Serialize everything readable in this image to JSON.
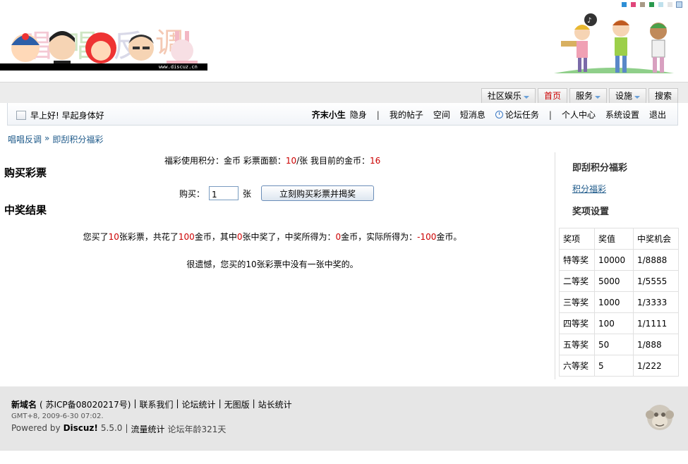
{
  "header": {
    "logo_url_text": "www.discuz.cn",
    "swatch_colors": [
      "#2e8fd6",
      "#e0457a",
      "#a89a86",
      "#2a9a4e",
      "#bfe0ec",
      "#e4e4e4",
      "#c0d8ee"
    ]
  },
  "nav": {
    "menu": [
      {
        "label": "社区娱乐",
        "dropdown": true,
        "active": false
      },
      {
        "label": "首页",
        "dropdown": false,
        "active": true
      },
      {
        "label": "服务",
        "dropdown": true,
        "active": false
      },
      {
        "label": "设施",
        "dropdown": true,
        "active": false
      },
      {
        "label": "搜索",
        "dropdown": false,
        "active": false
      }
    ]
  },
  "userbar": {
    "greeting": "早上好! 早起身体好",
    "username": "齐末小生",
    "invisible": "隐身",
    "my_posts": "我的帖子",
    "space": "空间",
    "messages": "短消息",
    "tasks": "论坛任务",
    "user_center": "个人中心",
    "settings": "系统设置",
    "logout": "退出",
    "separator": "|"
  },
  "breadcrumb": {
    "forum": "唱唱反调",
    "sep": "»",
    "current": "即刮积分福彩"
  },
  "main": {
    "info_prefix": "福彩使用积分：金币  彩票面额：",
    "ticket_price": "10",
    "info_mid": "/张  我目前的金币：",
    "my_coins": "16",
    "buy_title": "购买彩票",
    "buy_label": "购买：",
    "buy_value": "1",
    "buy_unit": "张",
    "buy_button": "立刻购买彩票并揭奖",
    "result_title": "中奖结果",
    "result": {
      "p1": "您买了",
      "count": "10",
      "p2": "张彩票，共花了",
      "spent": "100",
      "p3": "金币，其中",
      "won": "0",
      "p4": "张中奖了，中奖所得为：",
      "prize": "0",
      "p5": "金币，实际所得为：",
      "net": "-100",
      "p6": "金币。"
    },
    "sorry": "很遗憾，您买的10张彩票中没有一张中奖的。"
  },
  "sidebar": {
    "title": "即刮积分福彩",
    "link": "积分福彩",
    "prize_title": "奖项设置",
    "table": {
      "headers": [
        "奖项",
        "奖值",
        "中奖机会"
      ],
      "rows": [
        [
          "特等奖",
          "10000",
          "1/8888"
        ],
        [
          "二等奖",
          "5000",
          "1/5555"
        ],
        [
          "三等奖",
          "1000",
          "1/3333"
        ],
        [
          "四等奖",
          "100",
          "1/1111"
        ],
        [
          "五等奖",
          "50",
          "1/888"
        ],
        [
          "六等奖",
          "5",
          "1/222"
        ]
      ]
    }
  },
  "footer": {
    "site_name": "新域名",
    "icp": "( 苏ICP备08020217号)",
    "contact": "联系我们",
    "stats": "论坛统计",
    "archive": "无图版",
    "admin_stats": "站长统计",
    "time": "GMT+8, 2009-6-30 07:02.",
    "powered": "Powered by",
    "discuz": "Discuz!",
    "version": "5.5.0",
    "traffic": "流量统计",
    "age": "论坛年龄321天",
    "sep": "|"
  }
}
